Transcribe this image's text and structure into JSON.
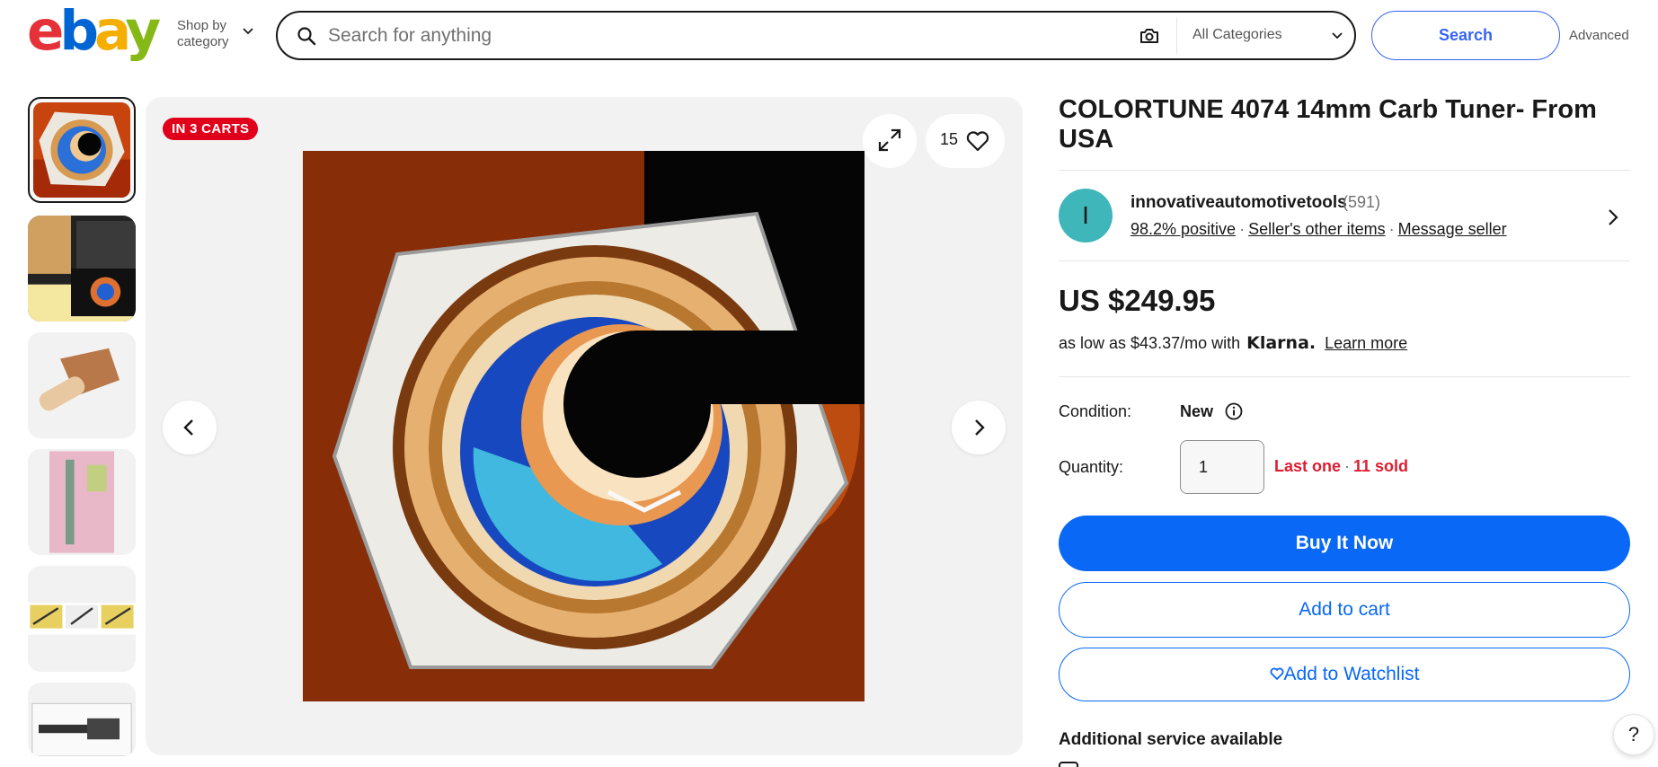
{
  "header": {
    "logo_letters": [
      "e",
      "b",
      "a",
      "y"
    ],
    "shop_by_line1": "Shop by",
    "shop_by_line2": "category",
    "search_placeholder": "Search for anything",
    "category_selected": "All Categories",
    "search_button": "Search",
    "advanced_link": "Advanced"
  },
  "gallery": {
    "carts_badge": "IN 3 CARTS",
    "watch_count": "15",
    "thumbnail_count": 6
  },
  "listing": {
    "title": "COLORTUNE 4074 14mm Carb Tuner- From USA",
    "seller": {
      "avatar_letter": "I",
      "name": "innovativeautomotivetools",
      "feedback_count": "(591)",
      "positive": "98.2% positive",
      "other_items": "Seller's other items",
      "message": "Message seller"
    },
    "price": "US $249.95",
    "financing_text": "as low as $43.37/mo with",
    "financing_brand": "Klarna.",
    "learn_more": "Learn more",
    "condition_label": "Condition:",
    "condition_value": "New",
    "quantity_label": "Quantity:",
    "quantity_value": "1",
    "availability": "Last one",
    "sold": "11 sold",
    "buy_now": "Buy It Now",
    "add_to_cart": "Add to cart",
    "add_to_watchlist": "Add to Watchlist",
    "additional_service": "Additional service available"
  },
  "help_label": "?",
  "colors": {
    "primary": "#0968f6",
    "alert": "#dd1e31",
    "badge": "#e0001c",
    "avatar": "#3fb6b9"
  }
}
